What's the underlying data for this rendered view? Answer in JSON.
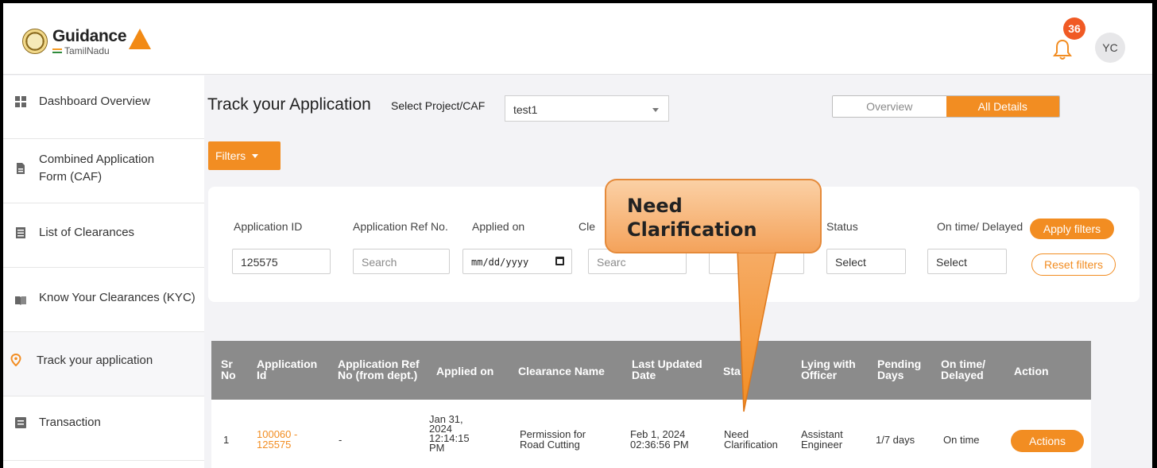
{
  "header": {
    "brand_line1": "Guidance",
    "brand_line2": "TamilNadu",
    "notification_count": "36",
    "avatar_initials": "YC"
  },
  "sidebar": {
    "items": [
      {
        "label": "Dashboard Overview",
        "icon": "grid-icon"
      },
      {
        "label": "Combined Application Form (CAF)",
        "icon": "document-icon"
      },
      {
        "label": "List of Clearances",
        "icon": "list-icon"
      },
      {
        "label": "Know Your Clearances (KYC)",
        "icon": "book-icon"
      },
      {
        "label": "Track your application",
        "icon": "location-pin-icon"
      },
      {
        "label": "Transaction",
        "icon": "receipt-icon"
      }
    ]
  },
  "main": {
    "title": "Track your Application",
    "project_label": "Select Project/CAF",
    "project_value": "test1",
    "view_toggle": {
      "overview": "Overview",
      "all_details": "All Details"
    },
    "filters_button": "Filters"
  },
  "filters": {
    "application_id": {
      "label": "Application ID",
      "value": "125575"
    },
    "application_ref": {
      "label": "Application Ref No.",
      "placeholder": "Search"
    },
    "applied_on": {
      "label": "Applied on",
      "value": "mm/dd/yyyy"
    },
    "clearance": {
      "label": "Cle",
      "placeholder": "Searc"
    },
    "status": {
      "label": "Status",
      "value": "Select"
    },
    "on_time": {
      "label": "On time/ Delayed",
      "value": "Select"
    },
    "apply_button": "Apply filters",
    "reset_button": "Reset filters"
  },
  "table": {
    "headers": {
      "sr_no": [
        "Sr",
        "No"
      ],
      "application_id": [
        "Application",
        "Id"
      ],
      "application_ref": [
        "Application Ref",
        "No (from dept.)"
      ],
      "applied_on": "Applied on",
      "clearance_name": "Clearance Name",
      "last_updated": [
        "Last Updated",
        "Date"
      ],
      "status": "Sta",
      "lying_with": [
        "Lying with",
        "Officer"
      ],
      "pending_days": [
        "Pending",
        "Days"
      ],
      "on_time": [
        "On time/",
        "Delayed"
      ],
      "action": "Action"
    },
    "rows": [
      {
        "sr_no": "1",
        "application_id": [
          "100060 -",
          "125575"
        ],
        "application_ref": "-",
        "applied_on": [
          "Jan 31,",
          "2024",
          "12:14:15",
          "PM"
        ],
        "clearance_name": [
          "Permission for",
          "Road Cutting"
        ],
        "last_updated": [
          "Feb 1, 2024",
          "02:36:56 PM"
        ],
        "status": [
          "Need",
          "Clarification"
        ],
        "lying_with": [
          "Assistant",
          "Engineer"
        ],
        "pending_days": "1/7 days",
        "on_time": "On time",
        "action_label": "Actions"
      }
    ]
  },
  "callout": {
    "line1": "Need",
    "line2": "Clarification"
  },
  "colors": {
    "accent": "#f28d22",
    "badge": "#f05a24",
    "table_header": "#8b8b8b"
  }
}
